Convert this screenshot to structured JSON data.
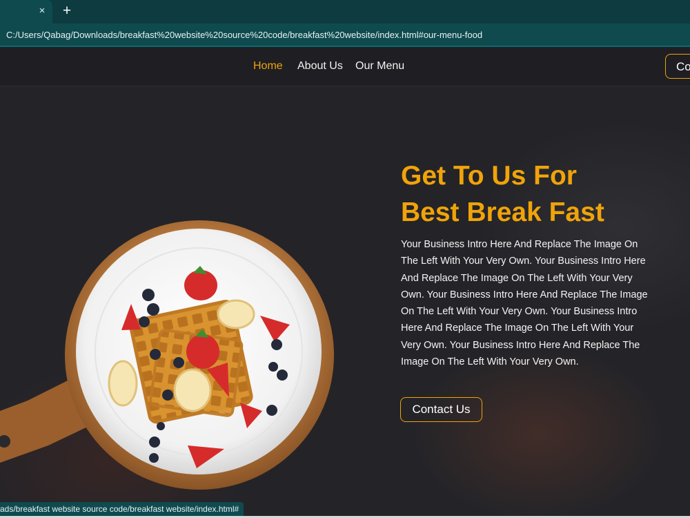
{
  "browser": {
    "tab_close_glyph": "×",
    "new_tab_glyph": "+",
    "url": "C:/Users/Qabag/Downloads/breakfast%20website%20source%20code/breakfast%20website/index.html#our-menu-food",
    "status_url": "ads/breakfast website source code/breakfast website/index.html#"
  },
  "nav": {
    "items": [
      {
        "label": "Home",
        "active": true
      },
      {
        "label": "About Us",
        "active": false
      },
      {
        "label": "Our Menu",
        "active": false
      }
    ],
    "cta_label": "Co"
  },
  "hero": {
    "title_line1": "Get To Us For",
    "title_line2": "Best Break Fast",
    "intro": "Your Business Intro Here And Replace The Image On The Left With Your Very Own. Your Business Intro Here And Replace The Image On The Left With Your Very Own. Your Business Intro Here And Replace The Image On The Left With Your Very Own. Your Business Intro Here And Replace The Image On The Left With Your Very Own. Your Business Intro Here And Replace The Image On The Left With Your Very Own.",
    "button_label": "Contact Us"
  },
  "colors": {
    "accent": "#f0a30a",
    "background": "#242428",
    "navbar": "#1f1f23",
    "chrome": "#0f4a4f"
  },
  "icons": {
    "hero_image": "waffle-plate-image",
    "tab_close": "close-icon",
    "new_tab": "plus-icon"
  }
}
